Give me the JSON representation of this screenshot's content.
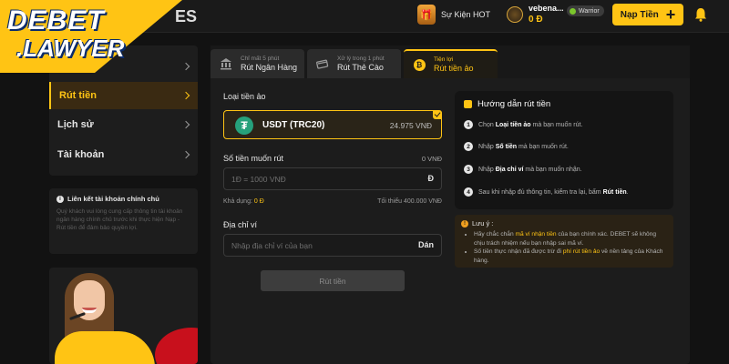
{
  "brand": {
    "logo_top": "DEBET",
    "logo_bottom": ".LAWYER",
    "brand_tail": "ES"
  },
  "header": {
    "event_label": "Sự Kiện HOT",
    "username": "vebena...",
    "balance": "0 Đ",
    "rank": "Warrior",
    "deposit_label": "Nạp Tiền",
    "icons": [
      "gift-icon",
      "avatar",
      "bell-icon"
    ]
  },
  "sidebar": {
    "items": [
      {
        "label": ""
      },
      {
        "label": "Rút tiền",
        "active": true
      },
      {
        "label": "Lịch sử"
      },
      {
        "label": "Tài khoản"
      }
    ],
    "link_box": {
      "title": "Liên kết tài khoản chính chủ",
      "text": "Quý khách vui lòng cung cấp thông tin tài khoản ngân hàng chính chủ trước khi thực hiện Nạp - Rút tiền để đảm bảo quyền lợi."
    }
  },
  "tabs": [
    {
      "sub": "Chỉ mất 5 phút",
      "label": "Rút Ngân Hàng",
      "icon": "bank-icon"
    },
    {
      "sub": "Xử lý trong 1 phút",
      "label": "Rút Thẻ Cào",
      "icon": "card-icon"
    },
    {
      "sub": "Tiện lợi",
      "label": "Rút tiền ảo",
      "icon": "bitcoin-icon",
      "active": true
    }
  ],
  "form": {
    "crypto_label": "Loại tiền ảo",
    "crypto_name": "USDT (TRC20)",
    "crypto_balance": "24.975 VNĐ",
    "amount_label": "Số tiền muốn rút",
    "amount_right": "0 VNĐ",
    "amount_placeholder": "1Đ = 1000 VNĐ",
    "amount_suffix": "Đ",
    "available_label": "Khả dụng:",
    "available_value": "0 Đ",
    "min_text": "Tối thiểu 400.000 VNĐ",
    "address_label": "Địa chỉ ví",
    "address_placeholder": "Nhập địa chỉ ví của bạn",
    "paste_label": "Dán",
    "submit_label": "Rút tiền"
  },
  "guide": {
    "title": "Hướng dẫn rút tiền",
    "steps": [
      {
        "n": "1",
        "pre": "Chọn ",
        "bold": "Loại tiền ảo",
        "post": " mà bạn muốn rút."
      },
      {
        "n": "2",
        "pre": "Nhập ",
        "bold": "Số tiền",
        "post": " mà bạn muốn rút."
      },
      {
        "n": "3",
        "pre": "Nhập ",
        "bold": "Địa chỉ ví",
        "post": " mà bạn muốn nhận."
      },
      {
        "n": "4",
        "pre": "Sau khi nhập đủ thông tin, kiểm tra lại, bấm ",
        "bold": "Rút tiền",
        "post": "."
      }
    ]
  },
  "note": {
    "title": "Lưu ý :",
    "line1_pre": "Hãy chắc chắn ",
    "line1_hl": "mã ví nhận tiền",
    "line1_post": " của bạn chính xác. DEBET sẽ không chịu trách nhiệm nếu bạn nhập sai mã ví.",
    "line2_pre": "Số tiền thực nhận đã được trừ đi ",
    "line2_hl": "phí rút tiền ảo",
    "line2_post": " về nền tảng của Khách hàng."
  },
  "colors": {
    "accent": "#ffc414",
    "tether": "#26a17b",
    "bg": "#121212",
    "panel": "#1c1c1c"
  }
}
